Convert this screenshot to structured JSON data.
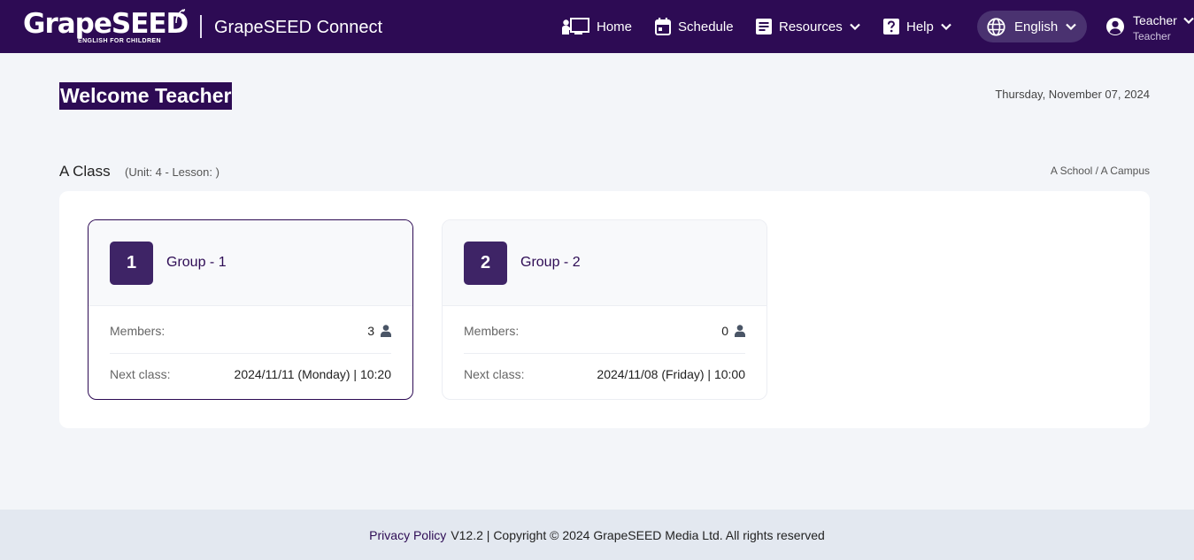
{
  "header": {
    "logo_text": "GrapeSEED",
    "logo_tagline": "ENGLISH FOR CHILDREN",
    "app_title": "GrapeSEED Connect",
    "nav": {
      "home": "Home",
      "schedule": "Schedule",
      "resources": "Resources",
      "help": "Help"
    },
    "language": "English",
    "user": {
      "name": "Teacher",
      "role": "Teacher"
    }
  },
  "main": {
    "welcome": "Welcome Teacher",
    "date": "Thursday, November 07, 2024",
    "class": {
      "name": "A Class",
      "subtitle": "(Unit: 4 - Lesson: )",
      "school": "A School / A Campus"
    },
    "groups": [
      {
        "number": "1",
        "name": "Group - 1",
        "members_label": "Members:",
        "members": "3",
        "next_label": "Next class:",
        "next_class": "2024/11/11 (Monday) | 10:20"
      },
      {
        "number": "2",
        "name": "Group - 2",
        "members_label": "Members:",
        "members": "0",
        "next_label": "Next class:",
        "next_class": "2024/11/08 (Friday) | 10:00"
      }
    ]
  },
  "footer": {
    "privacy": "Privacy Policy",
    "text": "V12.2 | Copyright © 2024 GrapeSEED Media Ltd. All rights reserved"
  },
  "icons": {
    "home": "teacher-board-icon",
    "schedule": "calendar-icon",
    "resources": "document-icon",
    "help": "question-icon",
    "language": "globe-icon",
    "user": "user-circle-icon",
    "members": "person-icon"
  },
  "colors": {
    "brand": "#2d0b54",
    "badge": "#3e2466",
    "pill": "#4a3270",
    "background": "#f3f5f9",
    "footer": "#e3e8f0"
  }
}
